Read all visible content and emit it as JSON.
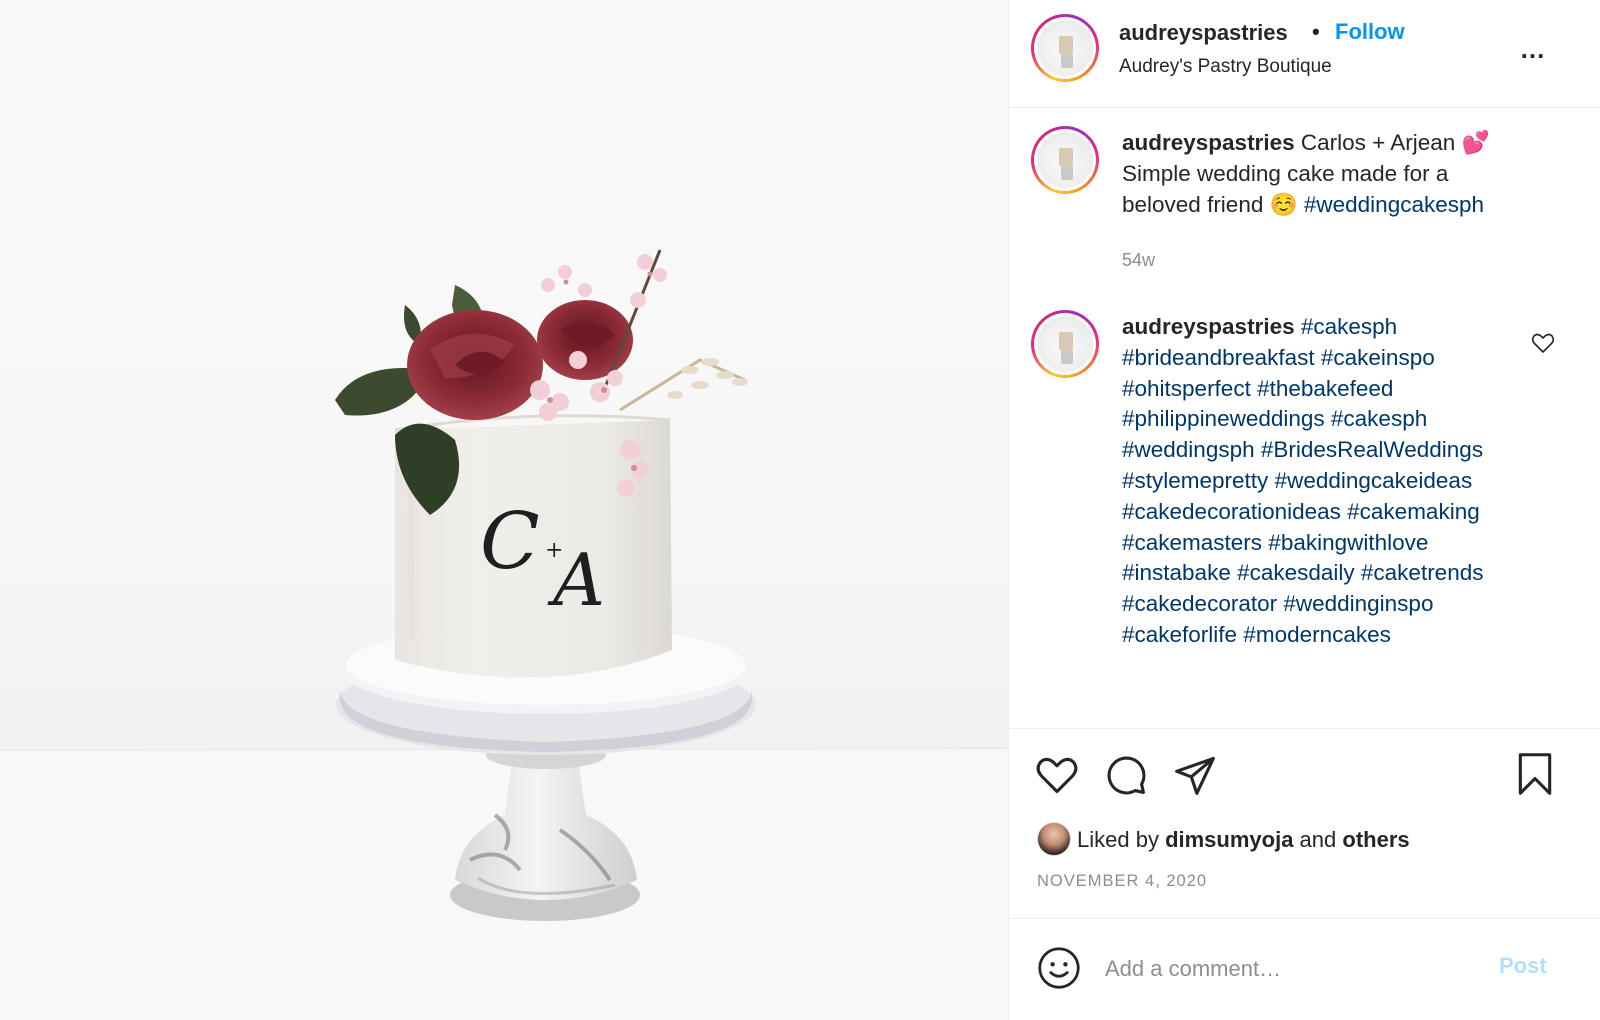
{
  "post": {
    "username": "audreyspastries",
    "separator": "•",
    "follow_label": "Follow",
    "display_name": "Audrey's Pastry Boutique",
    "more_label": "..."
  },
  "photo": {
    "monogram_c": "C",
    "monogram_plus": "+",
    "monogram_a": "A"
  },
  "caption": {
    "username": "audreyspastries",
    "text": " Carlos + Arjean 💕 Simple wedding cake made for a beloved friend ☺️ ",
    "hashtag": "#weddingcakesph",
    "time": "54w"
  },
  "comment": {
    "username": "audreyspastries",
    "hashtags": "#cakesph #brideandbreakfast #cakeinspo #ohitsperfect #thebakefeed #philippineweddings #cakesph #weddingsph #BridesRealWeddings #stylemepretty #weddingcakeideas #cakedecorationideas #cakemaking #cakemasters #bakingwithlove #instabake #cakesdaily #caketrends #cakedecorator #weddinginspo #cakeforlife #moderncakes"
  },
  "likes": {
    "prefix": "Liked by ",
    "user": "dimsumyoja",
    "middle": " and ",
    "others": "others"
  },
  "date": "NOVEMBER 4, 2020",
  "add_comment": {
    "placeholder": "Add a comment…",
    "post_label": "Post"
  },
  "colors": {
    "link_blue": "#0095f6",
    "hashtag": "#00376b",
    "muted": "#8e8e8e",
    "post_disabled": "#b2dffc"
  },
  "icons": [
    "heart-icon",
    "comment-icon",
    "share-icon",
    "bookmark-icon",
    "emoji-icon",
    "more-icon"
  ]
}
